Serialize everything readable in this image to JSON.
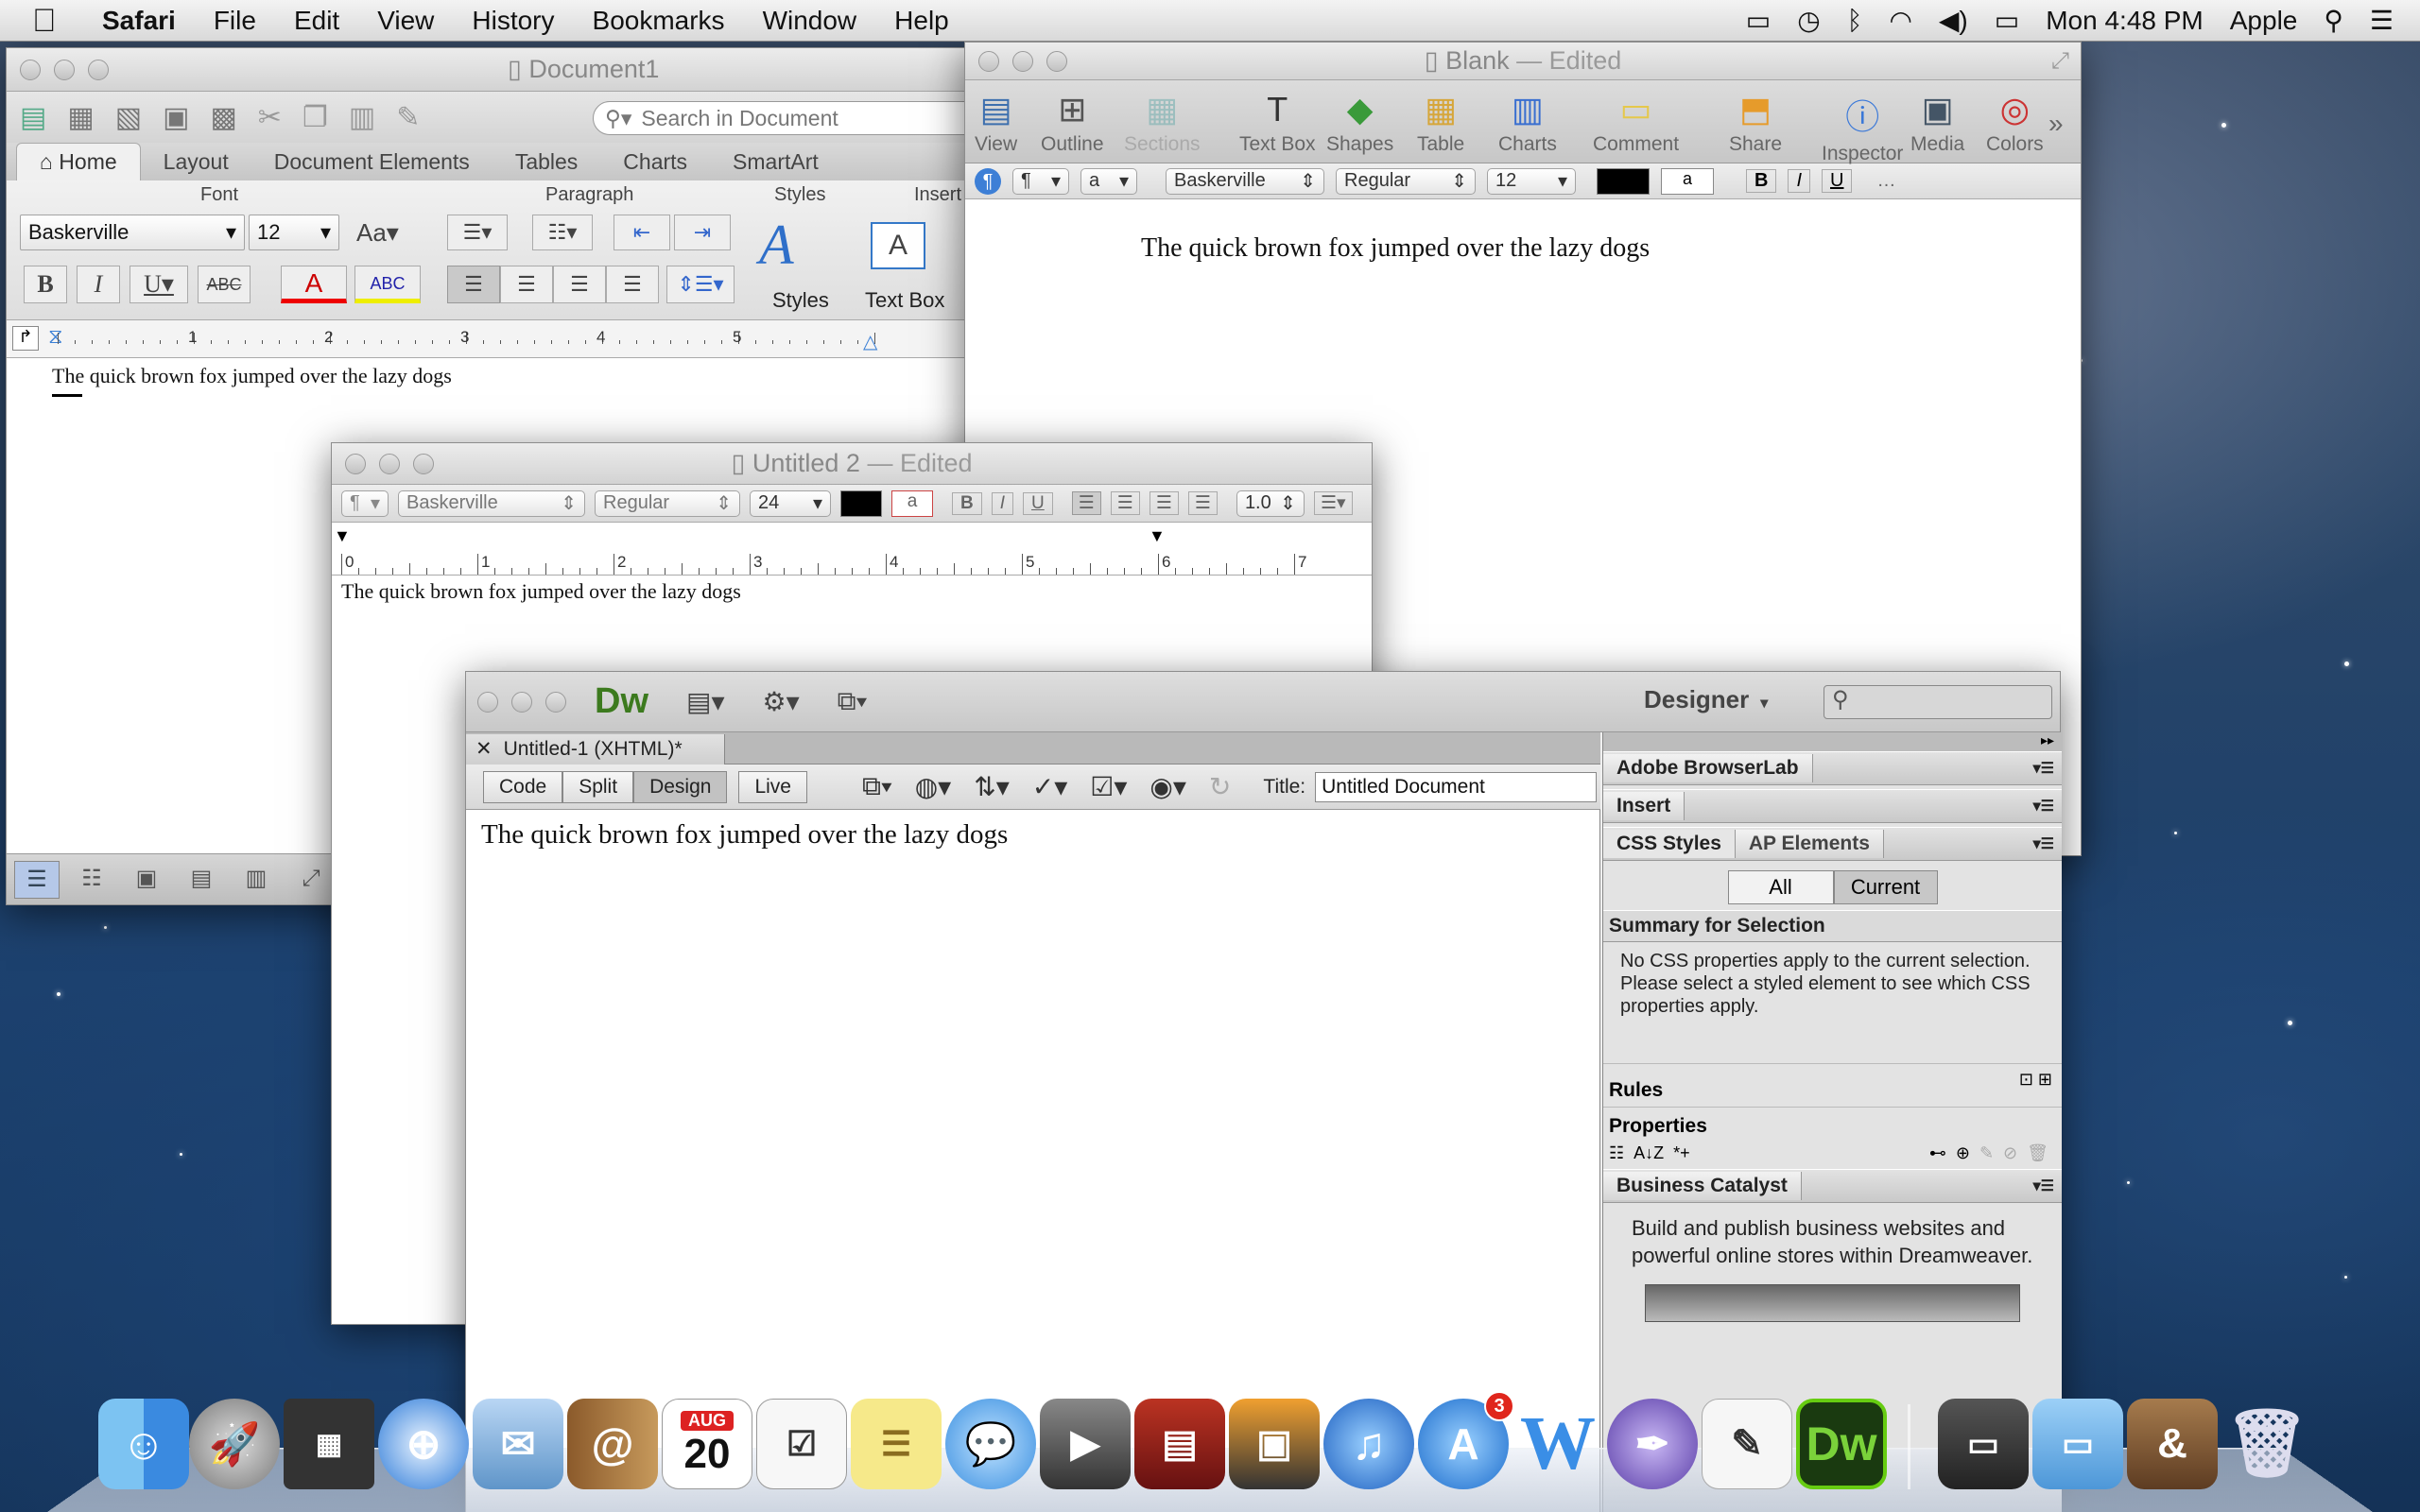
{
  "menubar": {
    "app": "Safari",
    "menus": [
      "File",
      "Edit",
      "View",
      "History",
      "Bookmarks",
      "Window",
      "Help"
    ],
    "clock": "Mon 4:48 PM",
    "user": "Apple"
  },
  "word": {
    "title": "Document1",
    "search_placeholder": "Search in Document",
    "tabs": [
      "Home",
      "Layout",
      "Document Elements",
      "Tables",
      "Charts",
      "SmartArt"
    ],
    "groups": {
      "font": "Font",
      "paragraph": "Paragraph",
      "styles": "Styles",
      "insert": "Insert"
    },
    "font_name": "Baskerville",
    "font_size": "12",
    "styles_label": "Styles",
    "textbox_label": "Text Box",
    "ruler_nums": [
      "1",
      "2",
      "3",
      "4",
      "5"
    ],
    "body": "The quick brown fox jumped over the lazy dogs"
  },
  "pages": {
    "title": "Blank",
    "edited": "— Edited",
    "toolbar": [
      "View",
      "Outline",
      "Sections",
      "Text Box",
      "Shapes",
      "Table",
      "Charts",
      "Comment",
      "Share",
      "Inspector",
      "Media",
      "Colors"
    ],
    "para_style": "¶",
    "char_style": "a",
    "font": "Baskerville",
    "weight": "Regular",
    "size": "12",
    "body": "The quick brown fox jumped over the lazy dogs"
  },
  "textedit": {
    "title": "Untitled 2",
    "edited": "— Edited",
    "para": "¶",
    "font": "Baskerville",
    "weight": "Regular",
    "size": "24",
    "spacing": "1.0",
    "ruler_nums": [
      "0",
      "1",
      "2",
      "3",
      "4",
      "5",
      "6",
      "7"
    ],
    "body": "The quick brown fox jumped over the lazy dogs"
  },
  "dw": {
    "logo": "Dw",
    "workspace": "Designer",
    "doc_tab": "Untitled-1 (XHTML)*",
    "views": [
      "Code",
      "Split",
      "Design",
      "Live"
    ],
    "title_label": "Title:",
    "title_value": "Untitled Document",
    "body": "The quick brown fox jumped over the lazy dogs",
    "panels": {
      "browserlab": "Adobe BrowserLab",
      "insert": "Insert",
      "css_styles": "CSS Styles",
      "ap": "AP Elements",
      "all": "All",
      "current": "Current",
      "summary": "Summary for Selection",
      "summary_text": "No CSS properties apply to the current selection.  Please select a styled element to see which CSS properties apply.",
      "rules": "Rules",
      "properties": "Properties",
      "bc": "Business Catalyst",
      "bc_text": "Build and publish business websites and powerful online stores within Dreamweaver."
    }
  },
  "dock": {
    "calendar_month": "AUG",
    "calendar_day": "20",
    "appstore_badge": "3",
    "dw_label": "Dw"
  },
  "colors": {
    "dw_green": "#3c9a1e",
    "accent_blue": "#3b7be0"
  }
}
